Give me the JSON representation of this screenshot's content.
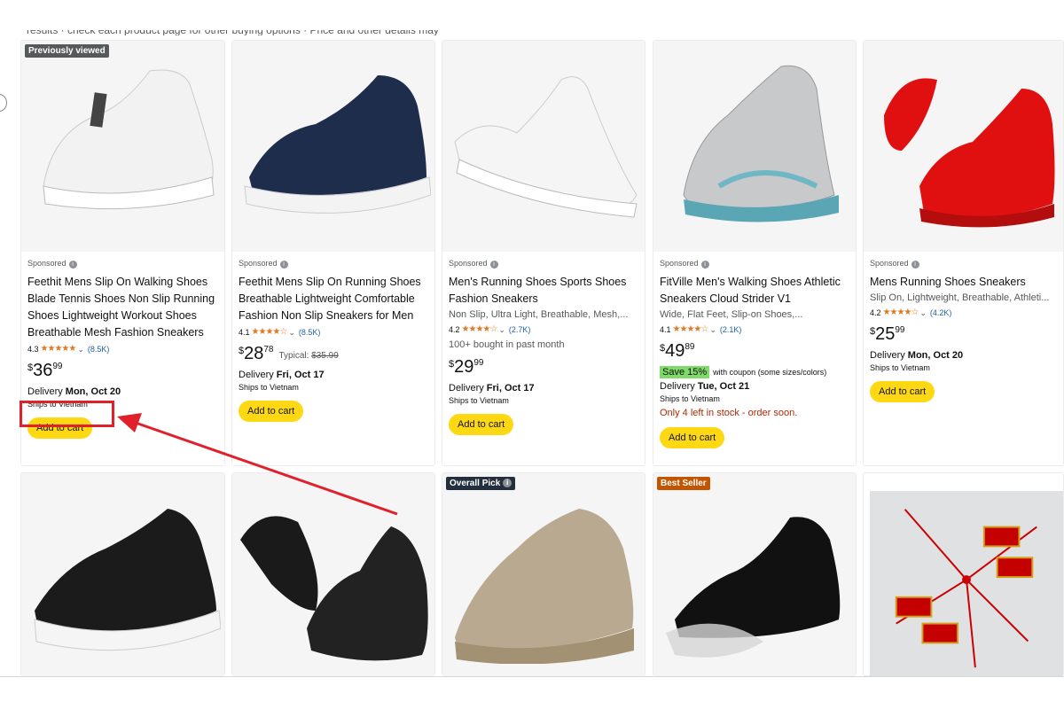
{
  "top_strip_text": "results · check each product page for other buying options · Price and other details may vary",
  "products": [
    {
      "badge": "Previously viewed",
      "sponsored": "Sponsored",
      "title": "Feethit Mens Slip On Walking Shoes Blade Tennis Shoes Non Slip Running Shoes Lightweight Workout Shoes Breathable Mesh Fashion Sneakers",
      "rating": "4.3",
      "rating_count": "(8.5K)",
      "price_symbol": "$",
      "price_whole": "36",
      "price_fraction": "99",
      "delivery_prefix": "Delivery",
      "delivery_date": "Mon, Oct 20",
      "ships": "Ships to Vietnam",
      "button": "Add to cart",
      "shoe_color": "white"
    },
    {
      "sponsored": "Sponsored",
      "title": "Feethit Mens Slip On Running Shoes Breathable Lightweight Comfortable Fashion Non Slip Sneakers for Men",
      "rating": "4.1",
      "rating_count": "(8.5K)",
      "price_symbol": "$",
      "price_whole": "28",
      "price_fraction": "78",
      "typical_label": "Typical:",
      "typical_price": "$35.99",
      "delivery_prefix": "Delivery",
      "delivery_date": "Fri, Oct 17",
      "ships": "Ships to Vietnam",
      "button": "Add to cart",
      "shoe_color": "navy"
    },
    {
      "sponsored": "Sponsored",
      "title": "Men's Running Shoes Sports Shoes Fashion Sneakers",
      "subtitle": "Non Slip, Ultra Light, Breathable, Mesh,...",
      "rating": "4.2",
      "rating_count": "(2.7K)",
      "bought": "100+ bought in past month",
      "price_symbol": "$",
      "price_whole": "29",
      "price_fraction": "99",
      "delivery_prefix": "Delivery",
      "delivery_date": "Fri, Oct 17",
      "ships": "Ships to Vietnam",
      "button": "Add to cart",
      "shoe_color": "white"
    },
    {
      "sponsored": "Sponsored",
      "title": "FitVille Men's Walking Shoes Athletic Sneakers Cloud Strider V1",
      "subtitle": "Wide, Flat Feet, Slip-on Shoes,...",
      "rating": "4.1",
      "rating_count": "(2.1K)",
      "price_symbol": "$",
      "price_whole": "49",
      "price_fraction": "89",
      "coupon_save": "Save 15%",
      "coupon_text": "with coupon (some sizes/colors)",
      "delivery_prefix": "Delivery",
      "delivery_date": "Tue, Oct 21",
      "ships": "Ships to Vietnam",
      "stock": "Only 4 left in stock - order soon.",
      "button": "Add to cart",
      "shoe_color": "gray"
    },
    {
      "sponsored": "Sponsored",
      "title": "Mens Running Shoes Sneakers",
      "subtitle": "Slip On, Lightweight, Breathable, Athleti...",
      "rating": "4.2",
      "rating_count": "(4.2K)",
      "price_symbol": "$",
      "price_whole": "25",
      "price_fraction": "99",
      "delivery_prefix": "Delivery",
      "delivery_date": "Mon, Oct 20",
      "ships": "Ships to Vietnam",
      "button": "Add to cart",
      "shoe_color": "red"
    }
  ],
  "row2": [
    {
      "shoe_color": "black"
    },
    {
      "shoe_color": "black"
    },
    {
      "badge": "Overall Pick",
      "shoe_color": "khaki"
    },
    {
      "badge": "Best Seller",
      "shoe_color": "black"
    },
    {
      "image_type": "decoration"
    }
  ],
  "colors": {
    "add_to_cart": "#ffd814",
    "stars": "#de7921",
    "link_blue": "#2162a1",
    "stock_red": "#b12704",
    "annotation_red": "#e0202a"
  }
}
